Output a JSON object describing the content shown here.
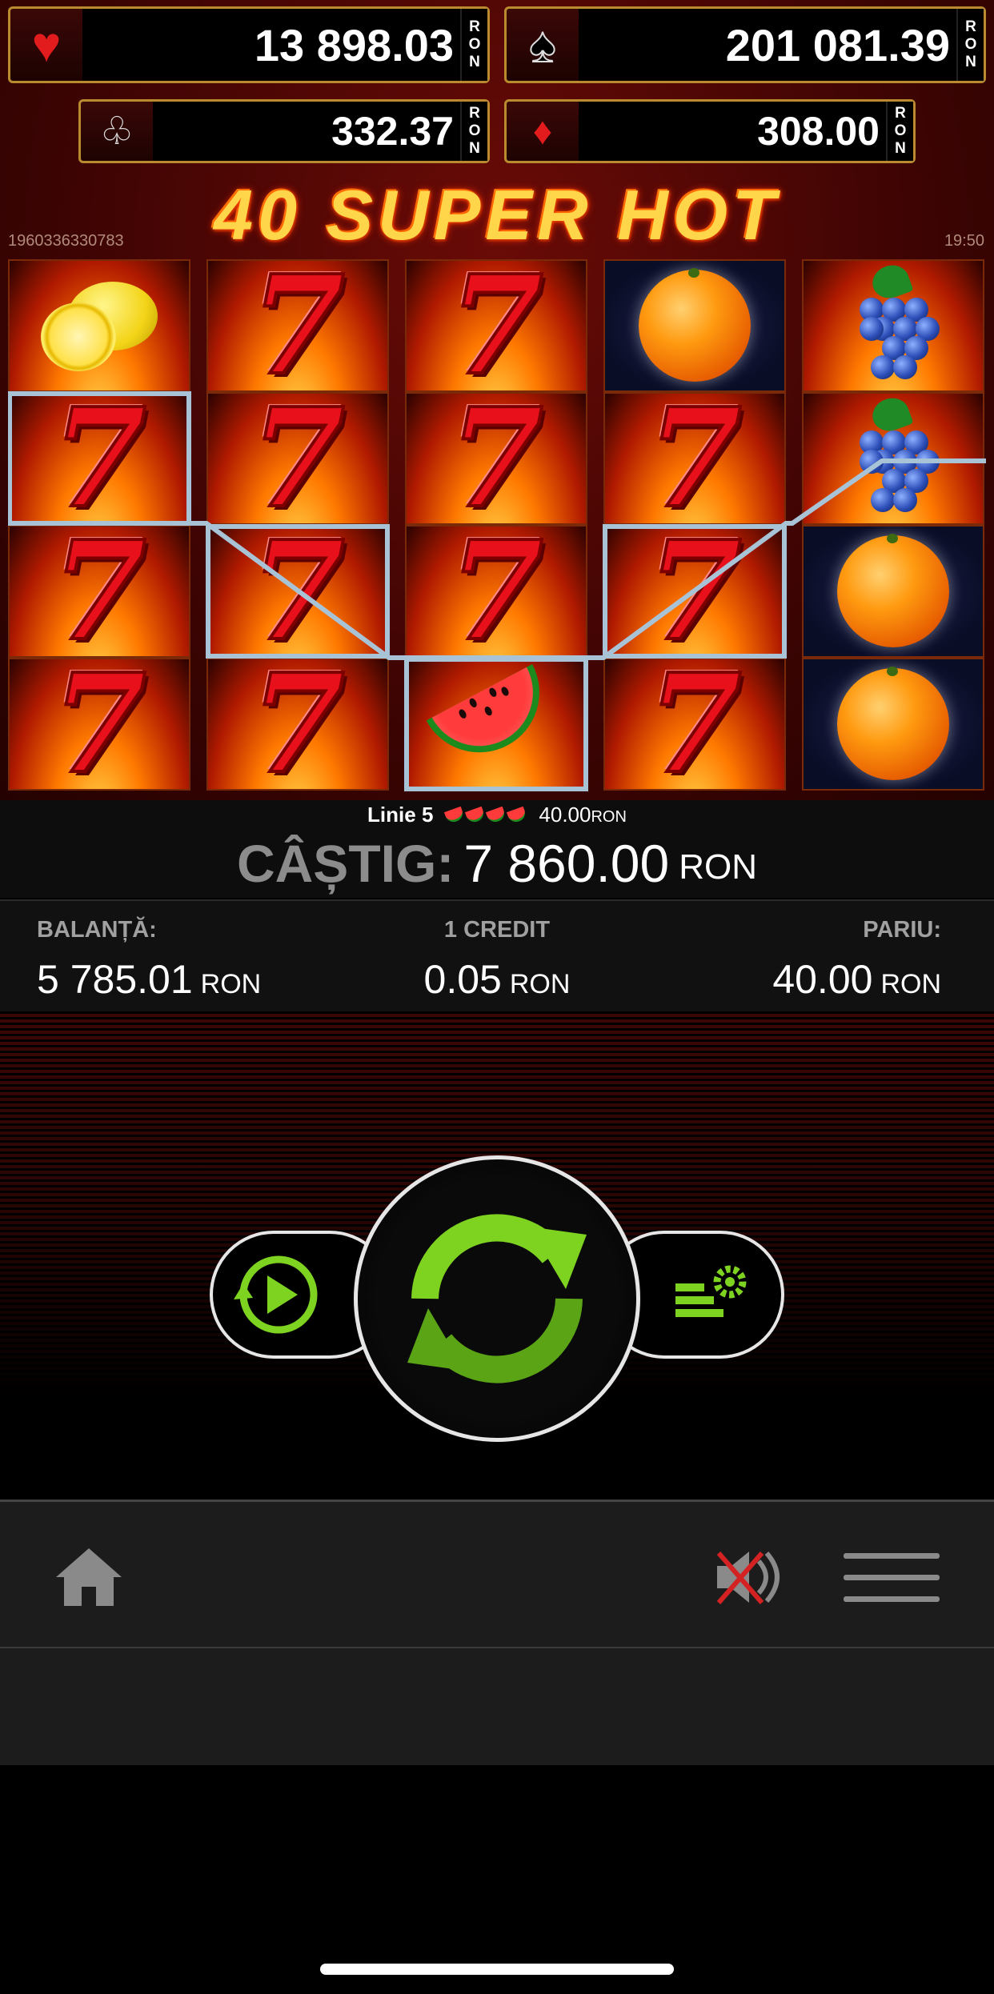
{
  "jackpots": {
    "hearts": {
      "value": "13 898.03",
      "currency": [
        "R",
        "O",
        "N"
      ],
      "suit": "♥",
      "color": "#e21c1c"
    },
    "spades": {
      "value": "201 081.39",
      "currency": [
        "R",
        "O",
        "N"
      ],
      "suit": "♠",
      "color": "#000000"
    },
    "clubs": {
      "value": "332.37",
      "currency": [
        "R",
        "O",
        "N"
      ],
      "suit": "♧",
      "color": "#000000"
    },
    "diamonds": {
      "value": "308.00",
      "currency": [
        "R",
        "O",
        "N"
      ],
      "suit": "♦",
      "color": "#e21c1c"
    }
  },
  "title": "40 SUPER HOT",
  "game_id": "1960336330783",
  "clock": "19:50",
  "reels": [
    [
      "lemon",
      "seven",
      "seven",
      "seven"
    ],
    [
      "seven",
      "seven",
      "seven",
      "seven"
    ],
    [
      "seven",
      "seven",
      "seven",
      "watermelon"
    ],
    [
      "orange",
      "seven",
      "seven",
      "seven"
    ],
    [
      "grapes",
      "grapes",
      "orange",
      "orange"
    ]
  ],
  "payline": {
    "line_label": "Linie 5",
    "symbol": "watermelon",
    "symbol_count": 4,
    "amount": "40.00",
    "currency": "RON"
  },
  "win": {
    "label": "CÂȘTIG:",
    "value": "7 860.00",
    "currency": "RON"
  },
  "stats": {
    "balance": {
      "label": "BALANȚĂ:",
      "value": "5 785.01",
      "currency": "RON"
    },
    "credit": {
      "label": "1 CREDIT",
      "value": "0.05",
      "currency": "RON"
    },
    "bet": {
      "label": "PARIU:",
      "value": "40.00",
      "currency": "RON"
    }
  },
  "colors": {
    "spin_green": "#7ed321",
    "accent_gold": "#b98a2e",
    "payline": "#a9c3d6"
  },
  "icons": {
    "autoplay": "autoplay-icon",
    "spin": "spin-icon",
    "settings": "bet-settings-icon",
    "home": "home-icon",
    "mute": "sound-muted-icon",
    "menu": "hamburger-menu-icon"
  }
}
